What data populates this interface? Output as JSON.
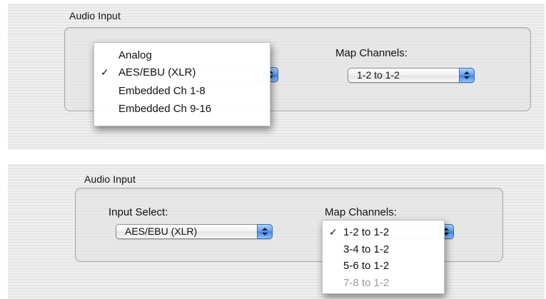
{
  "top_panel": {
    "group_title": "Audio Input",
    "map_channels_label": "Map Channels:",
    "map_channels_value": "1-2 to 1-2",
    "input_select_menu": {
      "items": [
        {
          "label": "Analog",
          "checked": false,
          "check": ""
        },
        {
          "label": "AES/EBU  (XLR)",
          "checked": true,
          "check": "✓"
        },
        {
          "label": "Embedded Ch 1-8",
          "checked": false,
          "check": ""
        },
        {
          "label": "Embedded Ch 9-16",
          "checked": false,
          "check": ""
        }
      ]
    }
  },
  "bottom_panel": {
    "group_title": "Audio Input",
    "input_select_label": "Input Select:",
    "input_select_value": "AES/EBU  (XLR)",
    "map_channels_label": "Map Channels:",
    "map_channels_menu": {
      "items": [
        {
          "label": "1-2 to 1-2",
          "checked": true,
          "enabled": true,
          "check": "✓"
        },
        {
          "label": "3-4 to 1-2",
          "checked": false,
          "enabled": true,
          "check": ""
        },
        {
          "label": "5-6 to 1-2",
          "checked": false,
          "enabled": true,
          "check": ""
        },
        {
          "label": "7-8 to 1-2",
          "checked": false,
          "enabled": false,
          "check": ""
        }
      ]
    }
  },
  "colors": {
    "accent_blue": "#5b9ef0",
    "disabled_text": "#9a9a9a"
  }
}
